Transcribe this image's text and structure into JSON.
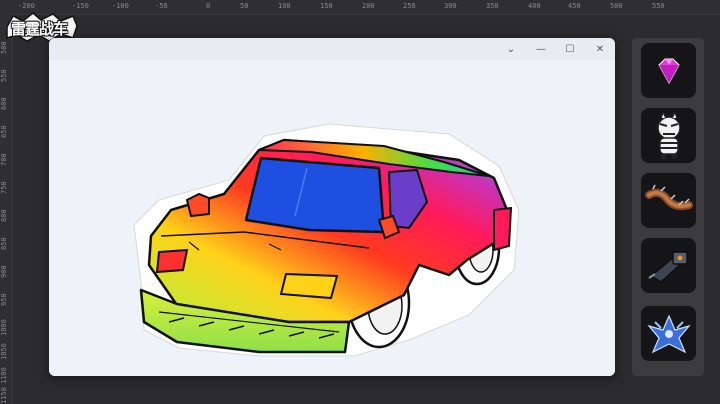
{
  "app": {
    "logo_text": "雷霆战车"
  },
  "ruler": {
    "top_labels": [
      "-200",
      "-150",
      "-100",
      "-50",
      "0",
      "50",
      "100",
      "150",
      "200",
      "250",
      "300",
      "350",
      "400",
      "450",
      "500",
      "550"
    ],
    "left_labels": [
      "500",
      "550",
      "600",
      "650",
      "700",
      "750",
      "800",
      "850",
      "900",
      "950",
      "1000",
      "1050",
      "1100",
      "1150"
    ]
  },
  "window": {
    "controls": {
      "dropdown": "⌄",
      "minimize": "—",
      "maximize": "☐",
      "close": "✕"
    }
  },
  "sidebar": {
    "items": [
      {
        "name": "gem-icon"
      },
      {
        "name": "zebra-character-icon"
      },
      {
        "name": "spiked-chain-icon"
      },
      {
        "name": "cannon-icon"
      },
      {
        "name": "robot-mech-icon"
      }
    ]
  },
  "colors": {
    "background": "#2b2b2d",
    "window": "#eef4f8",
    "panel": "#3b3b3e",
    "slot": "#151517"
  }
}
